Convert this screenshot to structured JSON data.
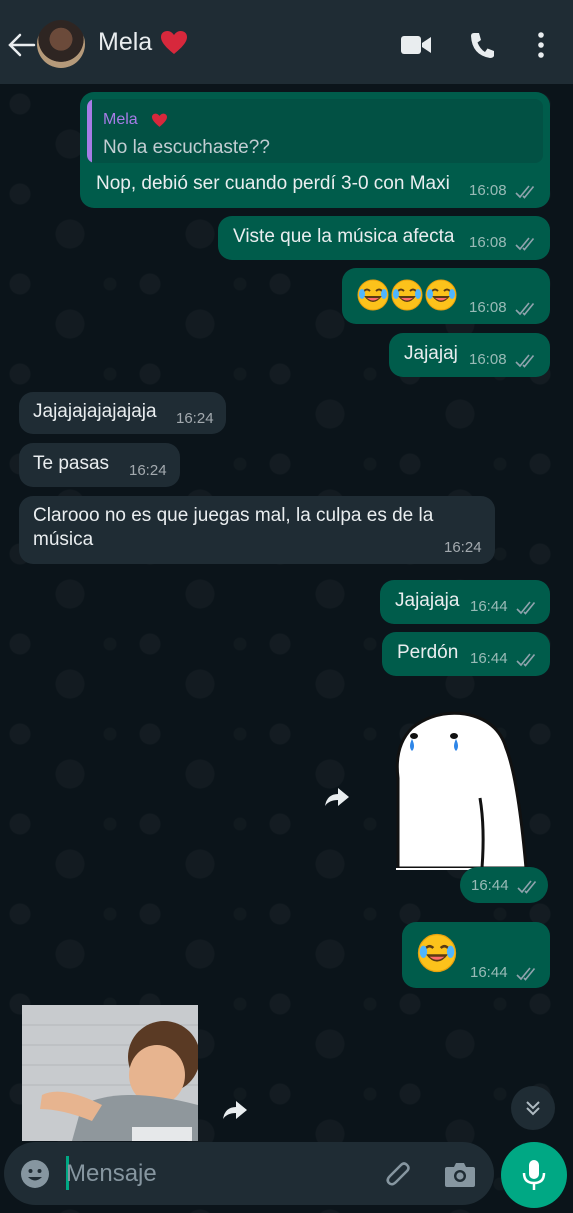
{
  "header": {
    "contact_name": "Mela",
    "icons": [
      "back-arrow-icon",
      "video-call-icon",
      "phone-icon",
      "more-options-icon"
    ]
  },
  "messages": [
    {
      "dir": "out",
      "quote_author": "Mela",
      "quote_text": "No la escuchaste??",
      "text": "Nop, debió ser cuando perdí 3-0 con Maxi",
      "time": "16:08",
      "status": "read"
    },
    {
      "dir": "out",
      "text": "Viste que la música afecta",
      "time": "16:08",
      "status": "read"
    },
    {
      "dir": "out",
      "emoji": "rolling-on-floor-laughing x3",
      "time": "16:08",
      "status": "read"
    },
    {
      "dir": "out",
      "text": "Jajajaj",
      "time": "16:08",
      "status": "read"
    },
    {
      "dir": "in",
      "text": "Jajajajajajajaja",
      "time": "16:24"
    },
    {
      "dir": "in",
      "text": "Te pasas",
      "time": "16:24"
    },
    {
      "dir": "in",
      "text_line1": "Clarooo no es que juegas mal, la culpa es de la",
      "text_line2": "música",
      "time": "16:24"
    },
    {
      "dir": "out",
      "text": "Jajajaja",
      "time": "16:44",
      "status": "read"
    },
    {
      "dir": "out",
      "text": "Perdón",
      "time": "16:44",
      "status": "read"
    },
    {
      "dir": "out",
      "sticker": "crying-blob-sticker",
      "time": "16:44",
      "status": "read"
    },
    {
      "dir": "out",
      "emoji": "rolling-on-floor-laughing",
      "time": "16:44",
      "status": "read"
    },
    {
      "dir": "in",
      "media": "video-thumbnail"
    }
  ],
  "composer": {
    "placeholder": "Mensaje",
    "icons": [
      "emoji-icon",
      "attach-icon",
      "camera-icon",
      "mic-icon"
    ]
  },
  "colors": {
    "background": "#0b141a",
    "header": "#1f2c34",
    "outgoing_bubble": "#005c4b",
    "incoming_bubble": "#1f2c34",
    "accent": "#00a884",
    "quote_author": "#a67ce6"
  }
}
